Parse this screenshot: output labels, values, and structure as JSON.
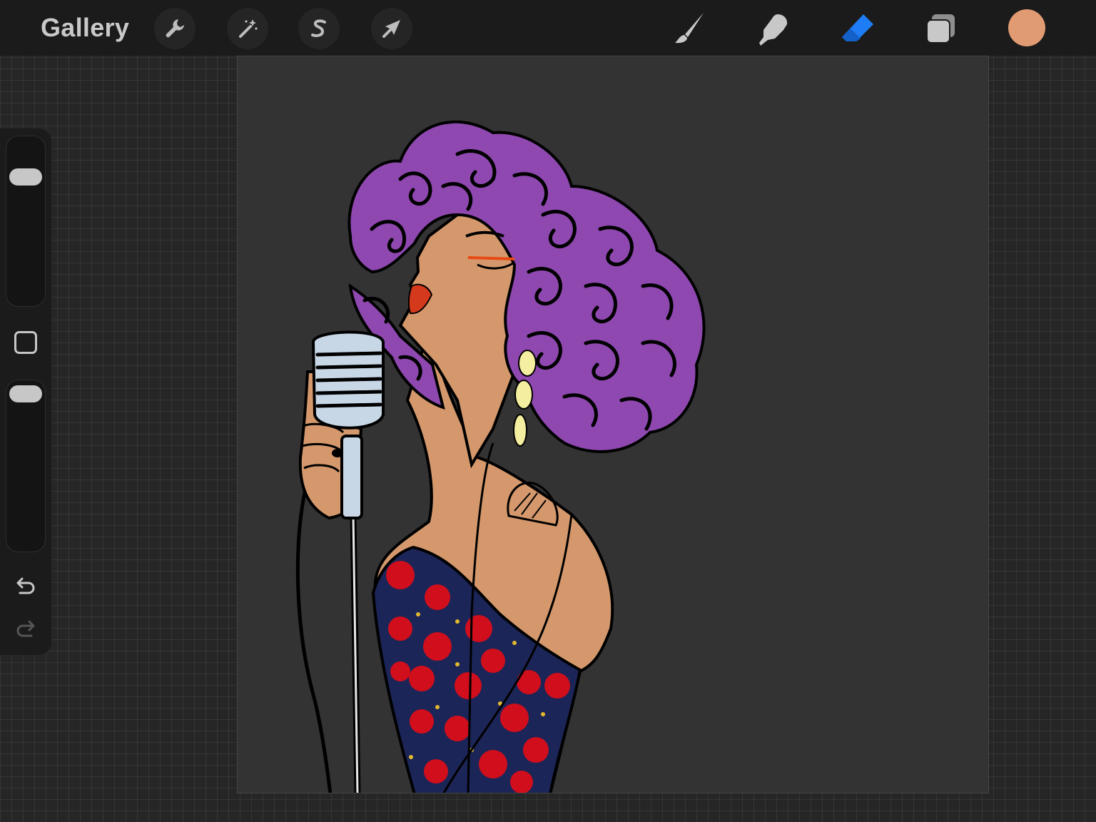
{
  "app": {
    "gallery_label": "Gallery"
  },
  "toolbar": {
    "left_tools": [
      {
        "name": "actions",
        "icon": "wrench-icon"
      },
      {
        "name": "adjustments",
        "icon": "magic-wand-icon"
      },
      {
        "name": "selection",
        "icon": "selection-s-icon"
      },
      {
        "name": "transform",
        "icon": "arrow-cursor-icon"
      }
    ],
    "right_tools": [
      {
        "name": "brush",
        "icon": "brush-icon"
      },
      {
        "name": "smudge",
        "icon": "smudge-finger-icon"
      },
      {
        "name": "eraser",
        "icon": "eraser-icon",
        "active": true
      },
      {
        "name": "layers",
        "icon": "layers-icon"
      }
    ],
    "active_color": "#E19B72",
    "accent_color": "#1E7CF5"
  },
  "sidebar": {
    "brush_size_icon": "brush-size-slider",
    "modify_icon": "modify-square-icon",
    "opacity_icon": "opacity-slider",
    "undo_icon": "undo-icon",
    "redo_icon": "redo-icon"
  },
  "canvas": {
    "artwork": "singer-illustration"
  }
}
